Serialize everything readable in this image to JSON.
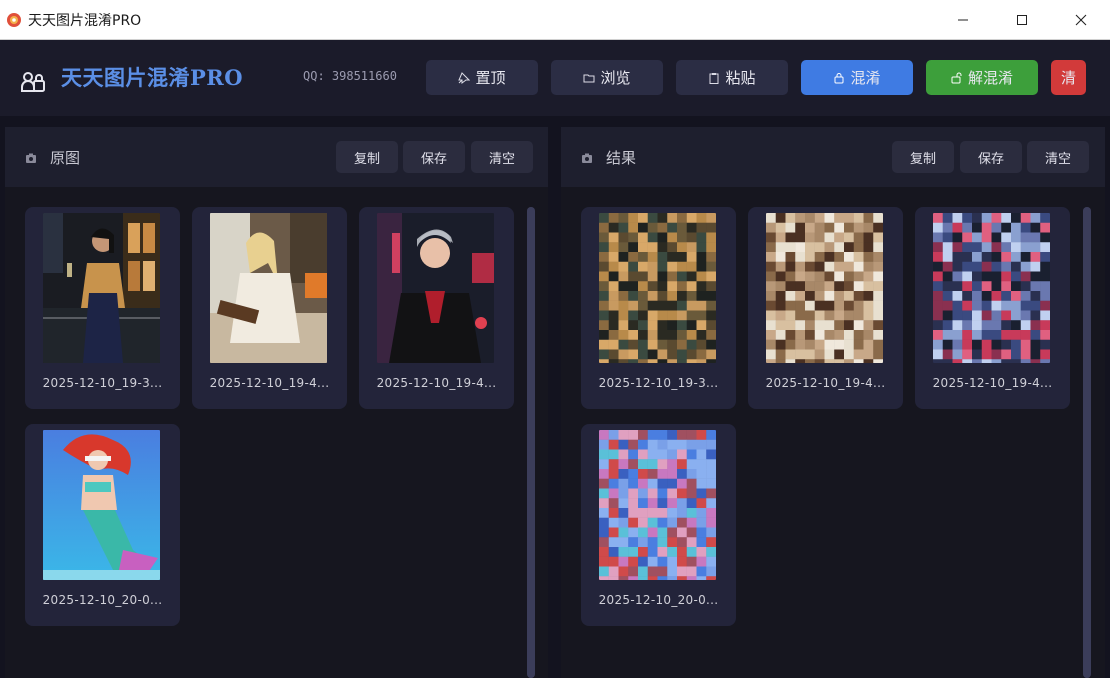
{
  "window": {
    "title": "天天图片混淆PRO"
  },
  "header": {
    "app_name": "天天图片混淆PRO",
    "qq": "QQ: 398511660",
    "buttons": {
      "pin": "置顶",
      "browse": "浏览",
      "paste": "粘贴",
      "obfuscate": "混淆",
      "deobfuscate": "解混淆",
      "clear": "清"
    },
    "colors": {
      "obfuscate": "#3f7be3",
      "deobfuscate": "#3d9f3b",
      "clear": "#d23a3a",
      "brand": "#5b8fe6"
    }
  },
  "left_panel": {
    "title": "原图",
    "copy": "复制",
    "save": "保存",
    "clear": "清空",
    "images": [
      {
        "name": "2025-12-10_19-3...",
        "picture": "woman-in-gold-dress-with-champagne"
      },
      {
        "name": "2025-12-10_19-4...",
        "picture": "blonde-woman-reading-book"
      },
      {
        "name": "2025-12-10_19-4...",
        "picture": "man-in-leather-jacket-city-night"
      },
      {
        "name": "2025-12-10_20-0...",
        "picture": "mermaid-underwater"
      }
    ]
  },
  "right_panel": {
    "title": "结果",
    "copy": "复制",
    "save": "保存",
    "clear": "清空",
    "images": [
      {
        "name": "2025-12-10_19-3...",
        "picture": "scrambled-tiles-gold-dark"
      },
      {
        "name": "2025-12-10_19-4...",
        "picture": "scrambled-tiles-beige-brown"
      },
      {
        "name": "2025-12-10_19-4...",
        "picture": "scrambled-tiles-red-blue"
      },
      {
        "name": "2025-12-10_20-0...",
        "picture": "scrambled-tiles-blue-pink"
      }
    ]
  }
}
